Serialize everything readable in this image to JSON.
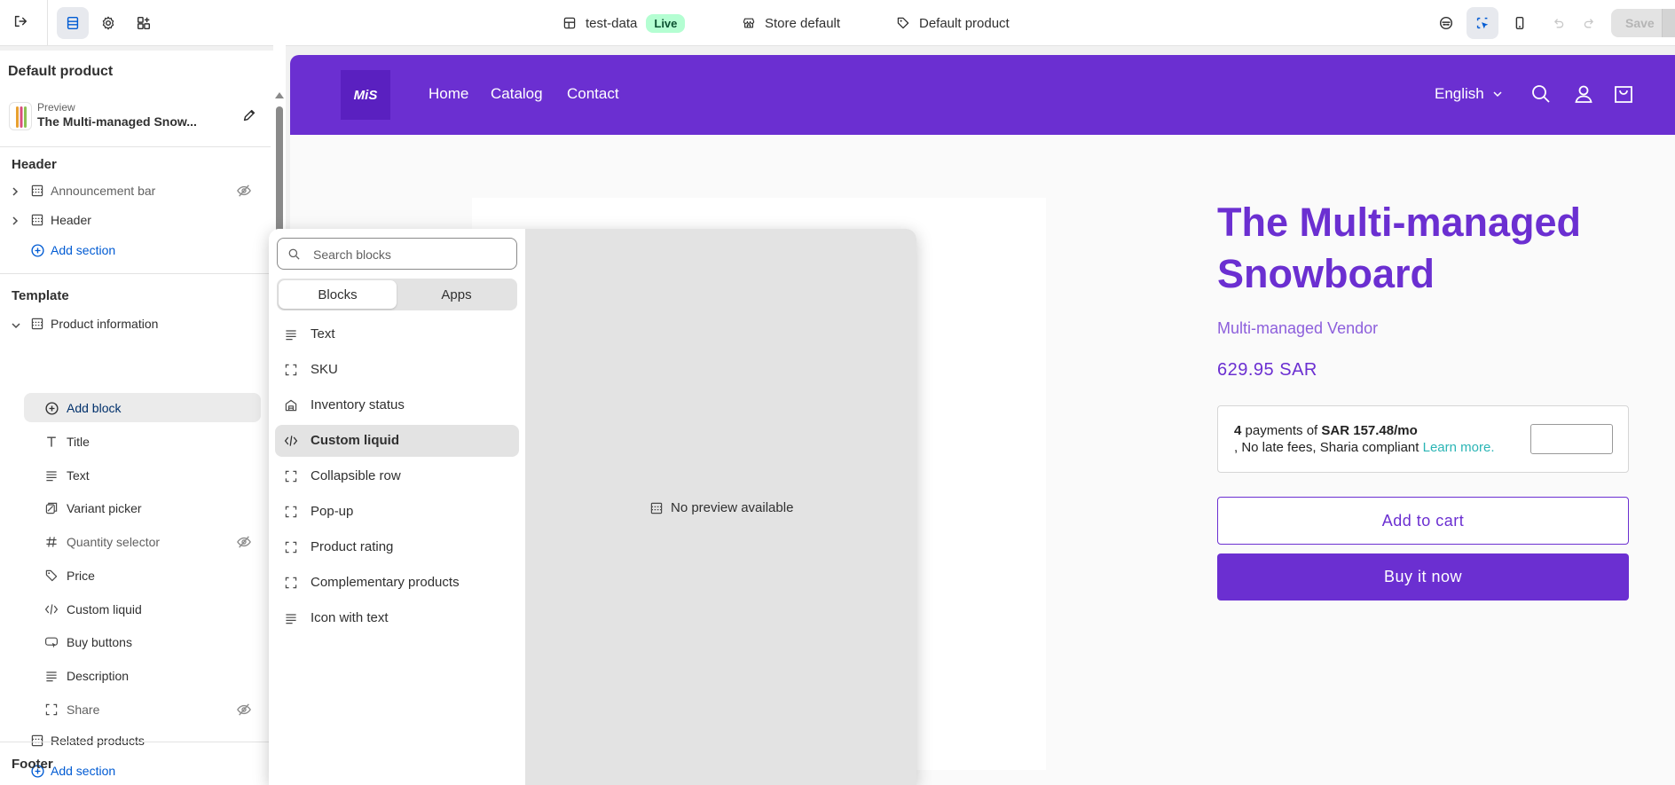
{
  "topbar": {
    "store": "test-data",
    "status": "Live",
    "theme": "Store default",
    "template": "Default product",
    "save_label": "Save"
  },
  "sidebar": {
    "title": "Default product",
    "preview_label": "Preview",
    "preview_name": "The Multi-managed Snow...",
    "header_title": "Header",
    "header_items": [
      "Announcement bar",
      "Header"
    ],
    "add_section": "Add section",
    "template_title": "Template",
    "product_info": "Product information",
    "add_block": "Add block",
    "blocks": [
      "Title",
      "Text",
      "Variant picker",
      "Quantity selector",
      "Price",
      "Custom liquid",
      "Buy buttons",
      "Description",
      "Share"
    ],
    "related": "Related products",
    "footer_title": "Footer"
  },
  "picker": {
    "search_placeholder": "Search blocks",
    "tabs": [
      "Blocks",
      "Apps"
    ],
    "items": [
      "Text",
      "SKU",
      "Inventory status",
      "Custom liquid",
      "Collapsible row",
      "Pop-up",
      "Product rating",
      "Complementary products",
      "Icon with text"
    ],
    "selected": "Custom liquid",
    "no_preview": "No preview available"
  },
  "store": {
    "logo": "MiS",
    "nav": [
      "Home",
      "Catalog",
      "Contact"
    ],
    "language": "English",
    "product_title": "The Multi-managed Snowboard",
    "vendor": "Multi-managed Vendor",
    "price": "629.95 SAR",
    "pay_count": "4",
    "pay_mid": " payments of ",
    "pay_amount": "SAR 157.48/mo",
    "pay_line2": ", No late fees, Sharia compliant ",
    "pay_link": "Learn more.",
    "add_to_cart": "Add to cart",
    "buy_now": "Buy it now",
    "accent_color": "#6b2fd1"
  }
}
